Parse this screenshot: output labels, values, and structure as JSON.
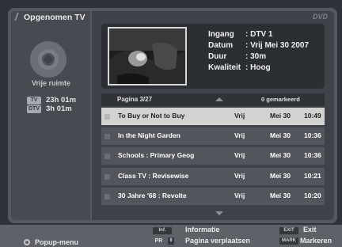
{
  "header": {
    "title": "Opgenomen TV",
    "logo": "DVD"
  },
  "sidebar": {
    "free_space_label": "Vrije ruimte",
    "storage": [
      {
        "badge": "TV",
        "time": "23h 01m"
      },
      {
        "badge": "DTV",
        "time": "3h 01m"
      }
    ]
  },
  "details": {
    "rows": [
      {
        "label": "Ingang",
        "value": ": DTV 1"
      },
      {
        "label": "Datum",
        "value": ": Vrij Mei 30 2007"
      },
      {
        "label": "Duur",
        "value": ": 30m"
      },
      {
        "label": "Kwaliteit",
        "value": ": Hoog"
      }
    ]
  },
  "list": {
    "page": "Pagina  3/27",
    "marked": "0 gemarkeerd",
    "items": [
      {
        "title": "To Buy or Not to Buy",
        "day": "Vrij",
        "date": "Mei 30",
        "time": "10:49",
        "selected": true
      },
      {
        "title": "In the Night Garden",
        "day": "Vrij",
        "date": "Mei 30",
        "time": "10:36"
      },
      {
        "title": "Schools : Primary Geog",
        "day": "Vrij",
        "date": "Mei 30",
        "time": "10:36"
      },
      {
        "title": "Class TV : Revisewise",
        "day": "Vrij",
        "date": "Mei 30",
        "time": "10:21"
      },
      {
        "title": "30 Jahre '68 : Revolte",
        "day": "Vrij",
        "date": "Mei 30",
        "time": "10:20"
      }
    ]
  },
  "footer": {
    "popup_label": "Popup-menu",
    "info_key": "Inf.",
    "info_label": "Informatie",
    "pr_key": "PR",
    "page_move_label": "Pagina verplaatsen",
    "exit_key": "EXIT",
    "exit_label": "Exit",
    "mark_key": "MARK",
    "mark_label": "Markeren"
  },
  "colors": {
    "selected_row": "#d2d2d0",
    "row": "#52555b",
    "panel": "#3f4248"
  }
}
